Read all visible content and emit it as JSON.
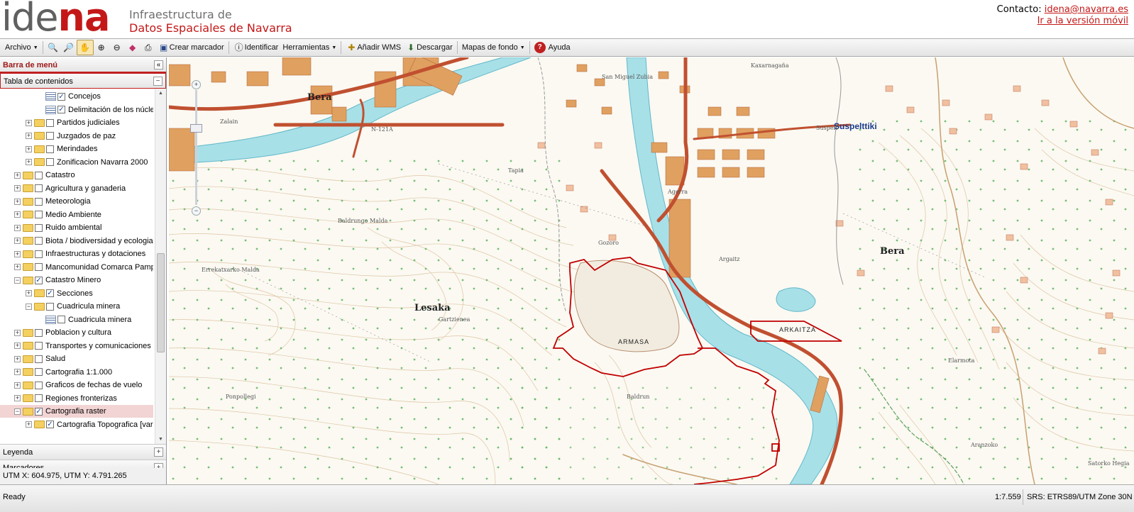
{
  "header": {
    "logo_part1": "ide",
    "logo_part2": "na",
    "subtitle_line1": "Infraestructura de",
    "subtitle_line2": "Datos Espaciales de Navarra",
    "contact_label": "Contacto:",
    "contact_email": "idena@navarra.es",
    "mobile_link": "Ir a la versión móvil"
  },
  "toolbar": {
    "archivo": "Archivo",
    "crear_marcador": "Crear marcador",
    "identificar": "Identificar",
    "herramientas": "Herramientas",
    "anadir_wms": "Añadir WMS",
    "descargar": "Descargar",
    "mapas_fondo": "Mapas de fondo",
    "ayuda": "Ayuda"
  },
  "left_panel": {
    "menu_title": "Barra de menú",
    "toc_title": "Tabla de contenidos",
    "leyenda": "Leyenda",
    "marcadores": "Marcadores",
    "coords": "UTM X: 604.975, UTM Y: 4.791.265",
    "tree": [
      {
        "label": "Concejos",
        "checked": true,
        "type": "layer"
      },
      {
        "label": "Delimitación de los núcleos",
        "checked": true,
        "type": "layer"
      },
      {
        "label": "Partidos judiciales",
        "checked": false,
        "type": "folder"
      },
      {
        "label": "Juzgados de paz",
        "checked": false,
        "type": "folder"
      },
      {
        "label": "Merindades",
        "checked": false,
        "type": "folder"
      },
      {
        "label": "Zonificacion Navarra 2000",
        "checked": false,
        "type": "folder"
      },
      {
        "label": "Catastro",
        "checked": false,
        "type": "folder"
      },
      {
        "label": "Agricultura y ganaderia",
        "checked": false,
        "type": "folder"
      },
      {
        "label": "Meteorologia",
        "checked": false,
        "type": "folder"
      },
      {
        "label": "Medio Ambiente",
        "checked": false,
        "type": "folder"
      },
      {
        "label": "Ruido ambiental",
        "checked": false,
        "type": "folder"
      },
      {
        "label": "Biota / biodiversidad y ecologia",
        "checked": false,
        "type": "folder"
      },
      {
        "label": "Infraestructuras y dotaciones",
        "checked": false,
        "type": "folder"
      },
      {
        "label": "Mancomunidad Comarca Pamplona",
        "checked": false,
        "type": "folder"
      },
      {
        "label": "Catastro Minero",
        "checked": true,
        "type": "folder-open"
      },
      {
        "label": "Secciones",
        "checked": true,
        "type": "folder"
      },
      {
        "label": "Cuadricula minera",
        "checked": false,
        "type": "folder-open"
      },
      {
        "label": "Cuadricula minera",
        "checked": false,
        "type": "layer"
      },
      {
        "label": "Poblacion y cultura",
        "checked": false,
        "type": "folder"
      },
      {
        "label": "Transportes y comunicaciones",
        "checked": false,
        "type": "folder"
      },
      {
        "label": "Salud",
        "checked": false,
        "type": "folder"
      },
      {
        "label": "Cartografia 1:1.000",
        "checked": false,
        "type": "folder"
      },
      {
        "label": "Graficos de fechas de vuelo",
        "checked": false,
        "type": "folder"
      },
      {
        "label": "Regiones fronterizas",
        "checked": false,
        "type": "folder"
      },
      {
        "label": "Cartografia raster",
        "checked": true,
        "type": "folder-open"
      },
      {
        "label": "Cartografia Topografica [varias]",
        "checked": true,
        "type": "folder"
      }
    ]
  },
  "map": {
    "labels": {
      "bera_nw": "Bera",
      "suspeltiki": "Suspelttiki",
      "bera_e": "Bera",
      "lesaka": "Lesaka",
      "armasa": "ARMASA",
      "arkaitza": "ARKAITZA",
      "baldrungo_malda": "Baldrungo Malda",
      "errekatxarko_malda": "Errekatxarko Malda",
      "ponpollegi": "Ponpollegi",
      "baldrun": "Baldrun",
      "agerra": "Agerra",
      "kaxarnagaña": "Kaxarnagaña",
      "san_miguel": "San Miguel Zubia",
      "zalain": "Zalain",
      "tapia": "Tapia",
      "gartzienea": "Gartzienea",
      "argaitz": "Argaitz",
      "elarmota": "Elarmota",
      "aranzoko": "Aranzoko",
      "satorko_hegia": "Satorko Hegia",
      "n121a": "N-121A",
      "suspelt_small": "Suspelt",
      "gozoro": "Gozoro"
    }
  },
  "status": {
    "ready": "Ready",
    "scale": "1:7.559",
    "srs": "SRS: ETRS89/UTM Zone 30N"
  }
}
